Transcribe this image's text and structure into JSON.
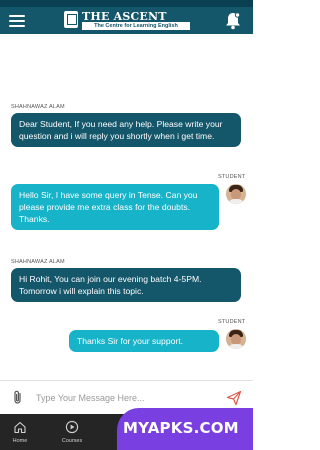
{
  "header": {
    "menu_icon": "hamburger-menu-icon",
    "logo_title": "THE ASCENT",
    "logo_subtitle": "The Centre for Learning English",
    "notification_icon": "bell-icon"
  },
  "messages": [
    {
      "sender": "SHAHNAWAZ ALAM",
      "text": "Dear Student, If you need any help. Please write your question and i will reply you shortly when i get time.",
      "direction": "incoming"
    },
    {
      "sender": "STUDENT",
      "text": "Hello Sir, I have some query in Tense. Can you please provide me extra class for the doubts. Thanks.",
      "direction": "outgoing"
    },
    {
      "sender": "SHAHNAWAZ ALAM",
      "text": "Hi Rohit, You can join our evening batch 4-5PM. Tomorrow i will explain this topic.",
      "direction": "incoming"
    },
    {
      "sender": "STUDENT",
      "text": "Thanks Sir for your support.",
      "direction": "outgoing"
    }
  ],
  "composer": {
    "placeholder": "Type Your Message Here...",
    "attach_icon": "paperclip-icon",
    "send_icon": "send-icon"
  },
  "bottom_nav": [
    {
      "label": "Home",
      "icon": "home-icon"
    },
    {
      "label": "Courses",
      "icon": "play-circle-icon"
    }
  ],
  "watermark": "MYAPKS.COM",
  "colors": {
    "primary": "#14566a",
    "status_bar": "#0b3f52",
    "outgoing_bubble": "#17b3c9",
    "send_accent": "#e05a4f",
    "nav_background": "#252525",
    "watermark": "#7a3fe0"
  }
}
